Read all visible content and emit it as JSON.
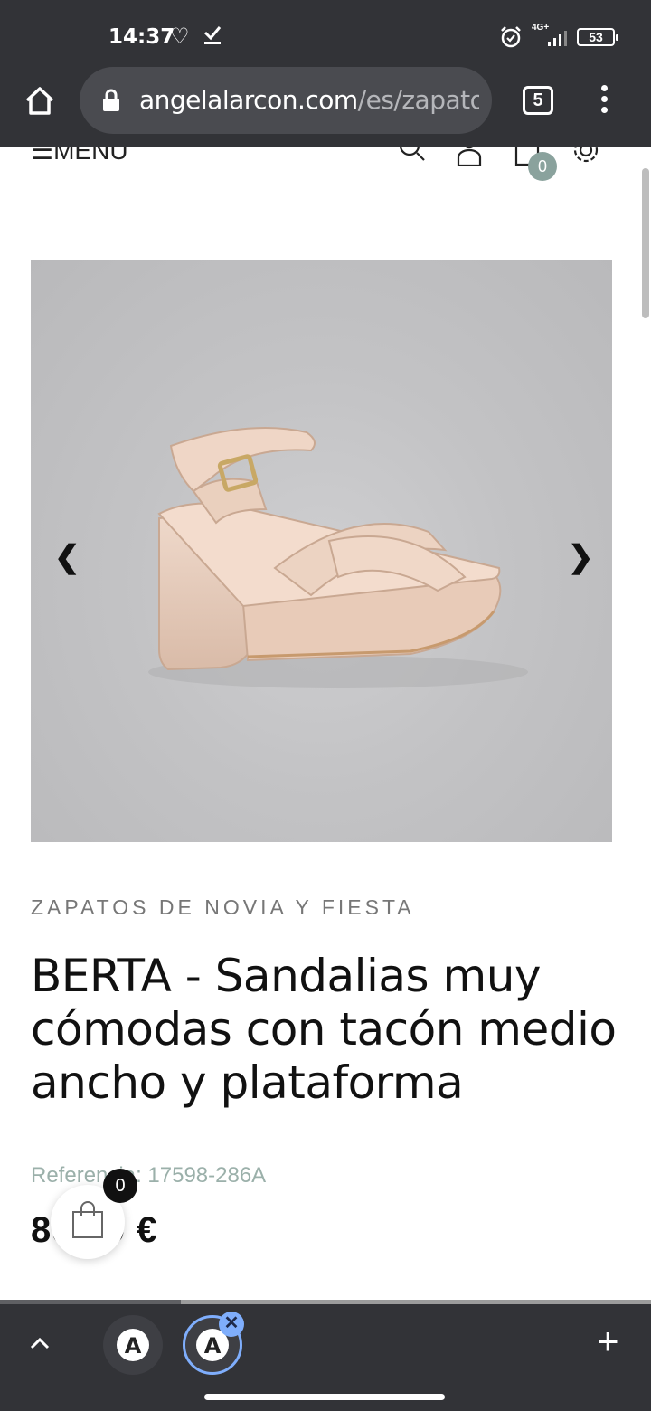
{
  "status_bar": {
    "time": "14:37",
    "network": "4G+",
    "battery": "53"
  },
  "browser": {
    "url_domain": "angelalarcon.com",
    "url_path": "/es/zapatos",
    "tab_count": "5"
  },
  "site_header": {
    "menu_label": "☰MENU",
    "cart_count": "0"
  },
  "carousel": {
    "prev_arrow": "❮",
    "next_arrow": "❯"
  },
  "product": {
    "category": "ZAPATOS DE NOVIA Y FIESTA",
    "title": "BERTA - Sandalias muy cómodas con tacón medio ancho y plataforma",
    "reference": "Referencia: 17598-286A",
    "price": "89,99 €"
  },
  "floating_cart": {
    "count": "0"
  },
  "bottom_bar": {
    "close_glyph": "✕",
    "new_tab_glyph": "+"
  },
  "icons": {
    "home": "home-icon",
    "lock": "lock-icon",
    "search": "search-icon",
    "user": "user-icon",
    "cart": "cart-icon",
    "settings": "gear-icon",
    "bag": "shopping-bag-icon"
  },
  "colors": {
    "chrome_dark": "#323337",
    "accent_teal": "#8aa29d",
    "tab_selected": "#7faefc"
  }
}
